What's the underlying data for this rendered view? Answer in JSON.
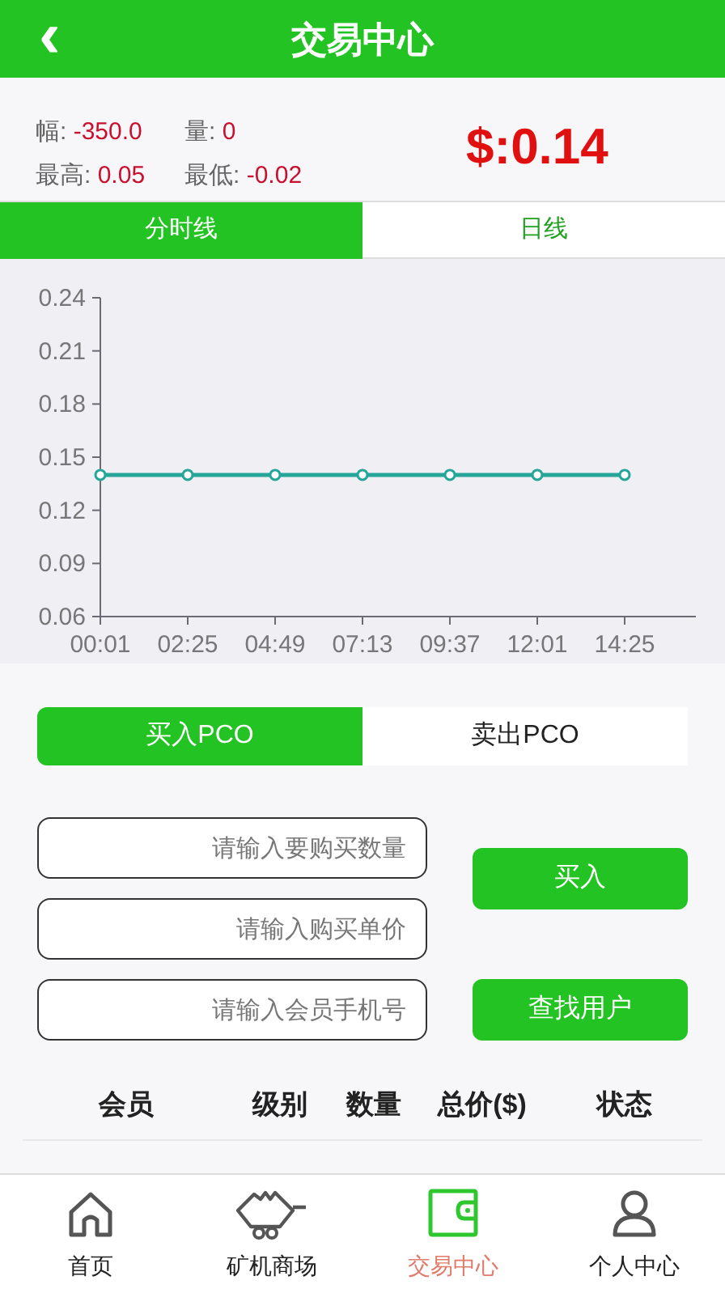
{
  "header": {
    "back": "‹",
    "title": "交易中心"
  },
  "stats": [
    {
      "label": "幅:",
      "value": "-350.0"
    },
    {
      "label": "量:",
      "value": "0"
    },
    {
      "label": "最高:",
      "value": "0.05"
    },
    {
      "label": "最低:",
      "value": "-0.02"
    }
  ],
  "price": "$:0.14",
  "chart_tabs": [
    {
      "label": "分时线",
      "selected": true
    },
    {
      "label": "日线",
      "selected": false
    }
  ],
  "chart": {
    "chart_data": {
      "type": "line",
      "categories": [
        "00:01",
        "02:25",
        "04:49",
        "07:13",
        "09:37",
        "12:01",
        "14:25"
      ],
      "series": [
        {
          "color": "#26a69a",
          "marker": "circle",
          "values": [
            0.14,
            0.14,
            0.14,
            0.14,
            0.14,
            0.14,
            0.14
          ]
        }
      ],
      "ylim": [
        0.06,
        0.24
      ],
      "yticks": [
        0.06,
        0.09,
        0.12,
        0.15,
        0.18,
        0.21,
        0.24
      ]
    }
  },
  "trade_tabs": [
    {
      "label": "买入PCO",
      "selected": true
    },
    {
      "label": "卖出PCO",
      "selected": false
    }
  ],
  "fields": [
    {
      "placeholder": "请输入要购买数量"
    },
    {
      "placeholder": "请输入购买单价"
    },
    {
      "placeholder": "请输入会员手机号"
    }
  ],
  "buttons": [
    "买入",
    "查找用户"
  ],
  "table": {
    "columns": [
      "会员",
      "级别",
      "数量",
      "总价($)",
      "状态"
    ]
  },
  "nav": [
    {
      "label": "首页",
      "kind": "home",
      "selected": false
    },
    {
      "label": "矿机商场",
      "kind": "cart",
      "selected": false
    },
    {
      "label": "交易中心",
      "kind": "wallet",
      "selected": true
    },
    {
      "label": "个人中心",
      "kind": "user",
      "selected": false
    }
  ]
}
